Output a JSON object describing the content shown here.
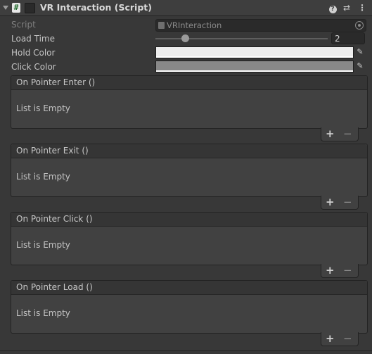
{
  "header": {
    "title": "VR Interaction (Script)",
    "script_icon_glyph": "#",
    "fold_icon": "triangle-down-icon",
    "help_glyph": "?",
    "presets_glyph": "⇄",
    "more_glyph": "⋮"
  },
  "fields": {
    "script_label": "Script",
    "script_value": "VRInteraction",
    "load_time_label": "Load Time",
    "load_time_value": "2",
    "hold_color_label": "Hold Color",
    "hold_color_hex": "#ededed",
    "click_color_label": "Click Color",
    "click_color_hex": "#888888"
  },
  "events": [
    {
      "title": "On Pointer Enter ()",
      "empty_text": "List is Empty"
    },
    {
      "title": "On Pointer Exit ()",
      "empty_text": "List is Empty"
    },
    {
      "title": "On Pointer Click ()",
      "empty_text": "List is Empty"
    },
    {
      "title": "On Pointer Load ()",
      "empty_text": "List is Empty"
    }
  ],
  "list_buttons": {
    "add": "+",
    "remove": "−"
  }
}
